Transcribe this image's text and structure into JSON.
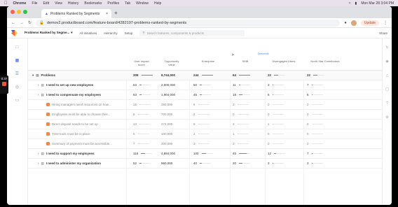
{
  "os_menu": {
    "app": "Chrome",
    "items": [
      "File",
      "Edit",
      "View",
      "History",
      "Bookmarks",
      "Profiles",
      "Tab",
      "Window",
      "Help"
    ],
    "clock": "Mon Mar 28  3:04 PM"
  },
  "browser": {
    "tab_title": "Problems Ranked by Segments",
    "url": "demov2.productboard.com/feature-board/4282197-problems-ranked-by-segments",
    "update_label": "Update"
  },
  "app": {
    "board_name": "Problems Ranked by Segme...",
    "toolbar_items": [
      "All initiatives",
      "Hierarchy",
      "Setup"
    ],
    "search_placeholder": "Search features, components & products",
    "share_label": "Share"
  },
  "recording": {
    "time": "0:37"
  },
  "columns": [
    {
      "key": "impact",
      "label": "User impact\nscore"
    },
    {
      "key": "opp",
      "label": "Opportunity\nvalue"
    },
    {
      "key": "ent",
      "label": "Enterprise"
    },
    {
      "key": "smb",
      "label": "SMB"
    },
    {
      "key": "dis",
      "label": "Disengaged Users"
    },
    {
      "key": "nsc",
      "label": "North Star Contributors"
    }
  ],
  "sort_label": "Descends",
  "rows": [
    {
      "name": "Problems",
      "level": 0,
      "bold": true,
      "impact": "308",
      "opp": "8,744,000",
      "ent": "244",
      "smb": "64",
      "dis": "22",
      "nsc": "22",
      "ent_fill": 0.8,
      "smb_fill": 0.5
    },
    {
      "name": "I need to set up new employees",
      "level": 1,
      "bold": true,
      "impact": "63",
      "opp": "2,000,000",
      "ent": "50",
      "smb": "11",
      "dis": "3",
      "nsc": "7"
    },
    {
      "name": "I need to compensate my employees",
      "level": 1,
      "bold": true,
      "impact": "63",
      "opp": "1,904,000",
      "ent": "45",
      "smb": "18",
      "dis": "6",
      "nsc": "5"
    },
    {
      "name": "Hiring managers need resources on how...",
      "level": 2,
      "bold": false,
      "impact": "16",
      "opp": "280,000",
      "ent": "6",
      "smb": "2",
      "dis": "0",
      "nsc": "0"
    },
    {
      "name": "Employees must be able to choose their...",
      "level": 2,
      "bold": false,
      "impact": "6",
      "opp": "700,000",
      "ent": "2",
      "smb": "0",
      "dis": "0",
      "nsc": "0"
    },
    {
      "name": "Direct deposit needs to be set up",
      "level": 2,
      "bold": false,
      "impact": "13",
      "opp": "474,000",
      "ent": "9",
      "smb": "3",
      "dis": "1",
      "nsc": "0"
    },
    {
      "name": "Time tools must be in place",
      "level": 2,
      "bold": false,
      "impact": "6",
      "opp": "100,000",
      "ent": "2",
      "smb": "1",
      "dis": "0",
      "nsc": "0"
    },
    {
      "name": "Summary of payment must be accessible...",
      "level": 2,
      "bold": false,
      "impact": "7",
      "opp": "200,000",
      "ent": "3",
      "smb": "3",
      "dis": "0",
      "nsc": "0"
    },
    {
      "name": "I need to support my employees",
      "level": 1,
      "bold": true,
      "impact": "118",
      "opp": "4,884,000",
      "ent": "100",
      "smb": "45",
      "dis": "12",
      "nsc": "7"
    },
    {
      "name": "I need to administer my organization",
      "level": 1,
      "bold": true,
      "impact": "52",
      "opp": "960,000",
      "ent": "40",
      "smb": "20",
      "dis": "3",
      "nsc": "3"
    }
  ],
  "colors": {
    "accent": "#4a90d9",
    "orange": "#f08a4b",
    "close": "#ff5f57",
    "minimize": "#febc2e",
    "maximize": "#28c840"
  }
}
